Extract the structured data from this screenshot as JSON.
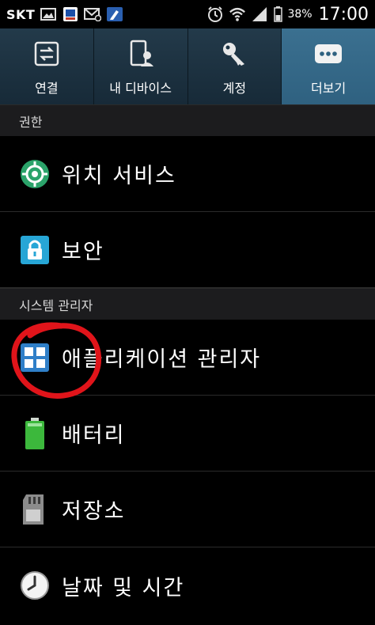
{
  "status_bar": {
    "carrier": "SKT",
    "battery_percent": "38%",
    "time": "17:00",
    "icons": [
      "gallery-icon",
      "app-notification-icon",
      "email-icon",
      "edit-icon",
      "alarm-icon",
      "wifi-icon",
      "signal-icon",
      "battery-icon"
    ]
  },
  "tabs": [
    {
      "label": "연결",
      "icon": "connection-icon",
      "active": false
    },
    {
      "label": "내 디바이스",
      "icon": "device-icon",
      "active": false
    },
    {
      "label": "계정",
      "icon": "key-icon",
      "active": false
    },
    {
      "label": "더보기",
      "icon": "more-icon",
      "active": true
    }
  ],
  "sections": [
    {
      "title": "권한"
    },
    {
      "title": "시스템 관리자"
    }
  ],
  "items": [
    {
      "label": "위치 서비스",
      "icon": "location-icon"
    },
    {
      "label": "보안",
      "icon": "lock-icon"
    },
    {
      "label": "애플리케이션 관리자",
      "icon": "app-grid-icon"
    },
    {
      "label": "배터리",
      "icon": "battery-green-icon"
    },
    {
      "label": "저장소",
      "icon": "sd-card-icon"
    },
    {
      "label": "날짜 및 시간",
      "icon": "clock-icon"
    }
  ],
  "colors": {
    "active_tab": "#3b7090",
    "annotation": "#e0141a"
  }
}
